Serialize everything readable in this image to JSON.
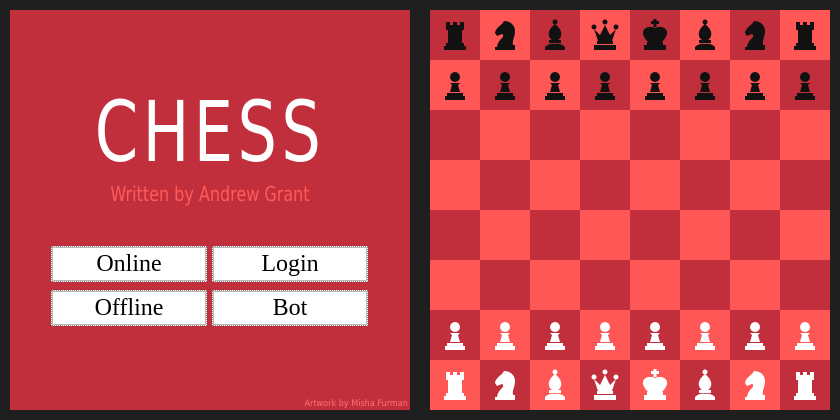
{
  "menu": {
    "title": "CHESS",
    "subtitle": "Written by Andrew Grant",
    "buttons": [
      {
        "label": "Online"
      },
      {
        "label": "Login"
      },
      {
        "label": "Offline"
      },
      {
        "label": "Bot"
      }
    ],
    "credit": "Artwork by Misha Furman"
  },
  "colors": {
    "panel": "#c22f3c",
    "light_square": "#ff5656",
    "dark_square": "#c22f3c",
    "accent_text": "#ff5a5a",
    "background": "#1f1f1f"
  },
  "board": {
    "ranks": [
      [
        "black-rook",
        "black-knight",
        "black-bishop",
        "black-queen",
        "black-king",
        "black-bishop",
        "black-knight",
        "black-rook"
      ],
      [
        "black-pawn",
        "black-pawn",
        "black-pawn",
        "black-pawn",
        "black-pawn",
        "black-pawn",
        "black-pawn",
        "black-pawn"
      ],
      [
        "",
        "",
        "",
        "",
        "",
        "",
        "",
        ""
      ],
      [
        "",
        "",
        "",
        "",
        "",
        "",
        "",
        ""
      ],
      [
        "",
        "",
        "",
        "",
        "",
        "",
        "",
        ""
      ],
      [
        "",
        "",
        "",
        "",
        "",
        "",
        "",
        ""
      ],
      [
        "white-pawn",
        "white-pawn",
        "white-pawn",
        "white-pawn",
        "white-pawn",
        "white-pawn",
        "white-pawn",
        "white-pawn"
      ],
      [
        "white-rook",
        "white-knight",
        "white-bishop",
        "white-queen",
        "white-king",
        "white-bishop",
        "white-knight",
        "white-rook"
      ]
    ]
  }
}
